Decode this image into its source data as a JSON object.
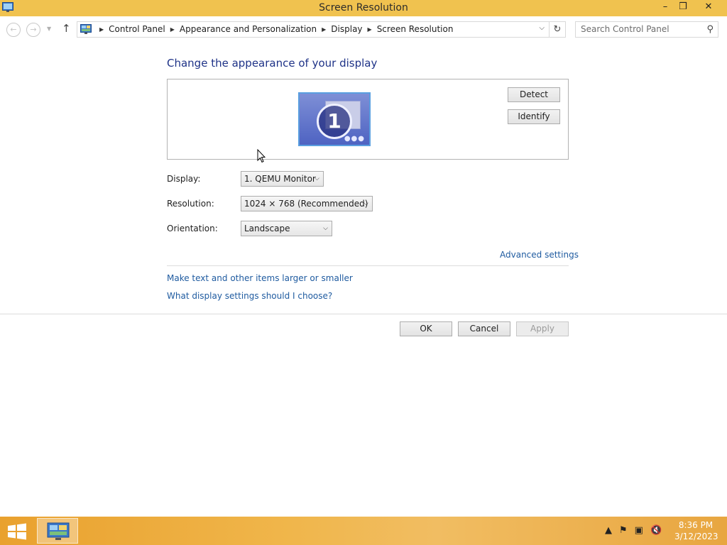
{
  "window": {
    "title": "Screen Resolution",
    "min_glyph": "–",
    "max_glyph": "❒",
    "close_glyph": "✕"
  },
  "nav": {
    "breadcrumbs": [
      "Control Panel",
      "Appearance and Personalization",
      "Display",
      "Screen Resolution"
    ],
    "search_placeholder": "Search Control Panel"
  },
  "main": {
    "heading": "Change the appearance of your display",
    "monitor_number": "1",
    "detect_label": "Detect",
    "identify_label": "Identify",
    "display_label": "Display:",
    "display_value": "1. QEMU Monitor",
    "resolution_label": "Resolution:",
    "resolution_value": "1024 × 768 (Recommended)",
    "orientation_label": "Orientation:",
    "orientation_value": "Landscape",
    "advanced_link": "Advanced settings",
    "larger_link": "Make text and other items larger or smaller",
    "choose_link": "What display settings should I choose?"
  },
  "footer": {
    "ok_label": "OK",
    "cancel_label": "Cancel",
    "apply_label": "Apply"
  },
  "taskbar": {
    "time": "8:36 PM",
    "date": "3/12/2023"
  },
  "colors": {
    "titlebar": "#f0c24f",
    "heading": "#1e3287",
    "link": "#1f5ba0",
    "taskbar": "#e9a12e"
  }
}
